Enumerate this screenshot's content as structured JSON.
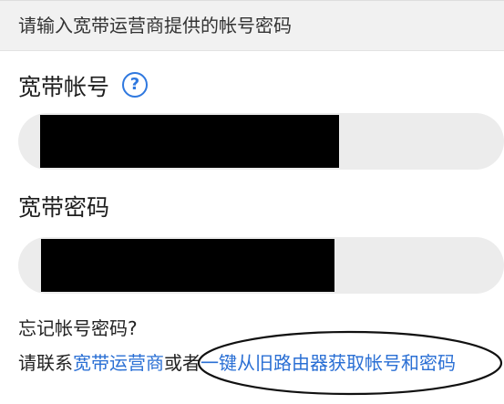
{
  "header": {
    "instruction": "请输入宽带运营商提供的帐号密码"
  },
  "account": {
    "label": "宽带帐号",
    "help_icon": "question-circle-icon"
  },
  "password": {
    "label": "宽带密码"
  },
  "footer": {
    "forgot_text": "忘记帐号密码?",
    "contact_prefix": "请联系",
    "isp_link": "宽带运营商",
    "or_text": "或者",
    "migrate_link": "一键从旧路由器获取帐号和密码"
  },
  "colors": {
    "link": "#2a6fd4",
    "help_icon": "#2f78df",
    "input_background": "#ececec",
    "header_background": "#f1f1f1"
  }
}
